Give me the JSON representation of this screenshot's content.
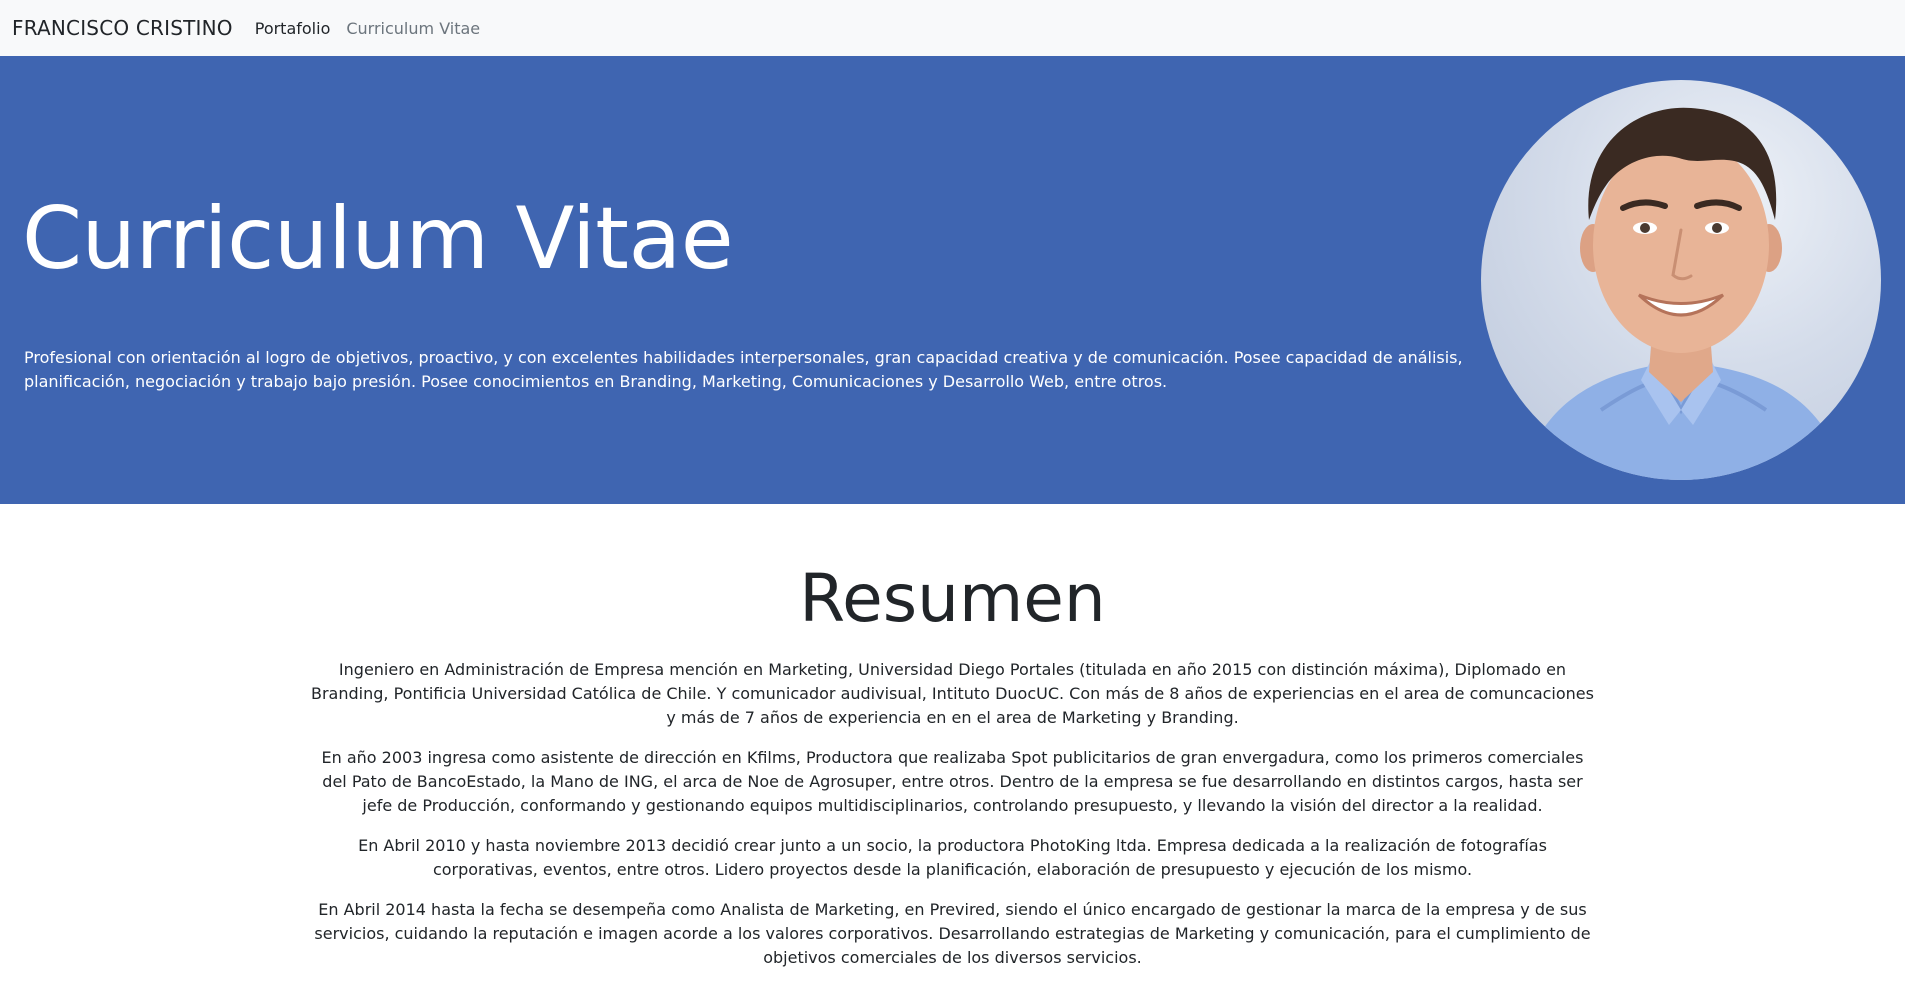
{
  "navbar": {
    "brand": "FRANCISCO CRISTINO",
    "links": [
      {
        "label": "Portafolio"
      },
      {
        "label": "Curriculum Vitae"
      }
    ]
  },
  "hero": {
    "title": "Curriculum Vitae",
    "text": "Profesional con orientación al logro de objetivos, proactivo, y con excelentes habilidades interpersonales, gran capacidad creativa y de comunicación. Posee capacidad de análisis, planificación, negociación y trabajo bajo presión. Posee conocimientos en Branding, Marketing, Comunicaciones y Desarrollo Web, entre otros.",
    "background_color": "#3f65b1",
    "photo": "profile-photo"
  },
  "resumen": {
    "title": "Resumen",
    "paragraphs": [
      "Ingeniero en Administración de Empresa mención en Marketing, Universidad Diego Portales (titulada en año 2015 con distinción máxima), Diplomado en Branding, Pontificia Universidad Católica de Chile. Y comunicador audivisual, Intituto DuocUC. Con más de 8 años de experiencias en el area de comuncaciones y más de 7 años de experiencia en en el area de Marketing y Branding.",
      "En año 2003 ingresa como asistente de dirección en Kfilms, Productora que realizaba Spot publicitarios de gran envergadura, como los primeros comerciales del Pato de BancoEstado, la Mano de ING, el arca de Noe de Agrosuper, entre otros. Dentro de la empresa se fue desarrollando en distintos cargos, hasta ser jefe de Producción, conformando y gestionando equipos multidisciplinarios, controlando presupuesto, y llevando la visión del director a la realidad.",
      "En Abril 2010 y hasta noviembre 2013 decidió crear junto a un socio, la productora PhotoKing ltda. Empresa dedicada a la realización de fotografías corporativas, eventos, entre otros. Lidero proyectos desde la planificación, elaboración de presupuesto y ejecución de los mismo.",
      "En Abril 2014 hasta la fecha se desempeña como Analista de Marketing, en Previred, siendo el único encargado de gestionar la marca de la empresa y de sus servicios, cuidando la reputación e imagen acorde a los valores corporativos. Desarrollando estrategias de Marketing y comunicación, para el cumplimiento de objetivos comerciales de los diversos servicios."
    ]
  }
}
